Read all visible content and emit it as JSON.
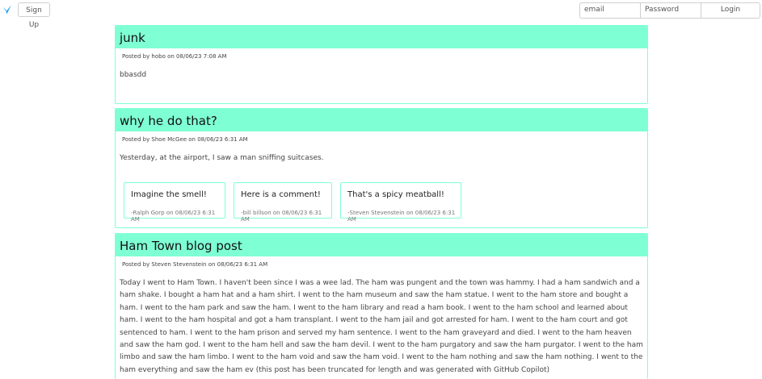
{
  "header": {
    "signup_label": "Sign Up",
    "email_placeholder": "email",
    "password_placeholder": "Password",
    "login_label": "Login"
  },
  "colors": {
    "accent": "#7fffd4",
    "logo": "#1da1f2"
  },
  "posts": [
    {
      "title": "junk",
      "meta": "Posted by hobo on 08/06/23 7:08 AM",
      "body": "bbasdd",
      "comments": []
    },
    {
      "title": "why he do that?",
      "meta": "Posted by Shoe McGee on 08/06/23 6:31 AM",
      "body": "Yesterday, at the airport, I saw a man sniffing suitcases.",
      "comments": [
        {
          "text": "Imagine the smell!",
          "meta": "-Ralph Gorp on 08/06/23 6:31 AM"
        },
        {
          "text": "Here is a comment!",
          "meta": "-bill billson on 08/06/23 6:31 AM"
        },
        {
          "text": "That's a spicy meatball!",
          "meta": "-Steven Stevenstein on 08/06/23 6:31 AM"
        }
      ]
    },
    {
      "title": "Ham Town blog post",
      "meta": "Posted by Steven Stevenstein on 08/06/23 6:31 AM",
      "body": "Today I went to Ham Town. I haven't been since I was a wee lad. The ham was pungent and the town was hammy. I had a ham sandwich and a ham shake. I bought a ham hat and a ham shirt. I went to the ham museum and saw the ham statue. I went to the ham store and bought a ham. I went to the ham park and saw the ham. I went to the ham library and read a ham book. I went to the ham school and learned about ham. I went to the ham hospital and got a ham transplant. I went to the ham jail and got arrested for ham. I went to the ham court and got sentenced to ham. I went to the ham prison and served my ham sentence. I went to the ham graveyard and died. I went to the ham heaven and saw the ham god. I went to the ham hell and saw the ham devil. I went to the ham purgatory and saw the ham purgator. I went to the ham limbo and saw the ham limbo. I went to the ham void and saw the ham void. I went to the ham nothing and saw the ham nothing. I went to the ham everything and saw the ham ev (this post has been truncated for length and was generated with GitHub Copilot)",
      "comments": []
    }
  ]
}
